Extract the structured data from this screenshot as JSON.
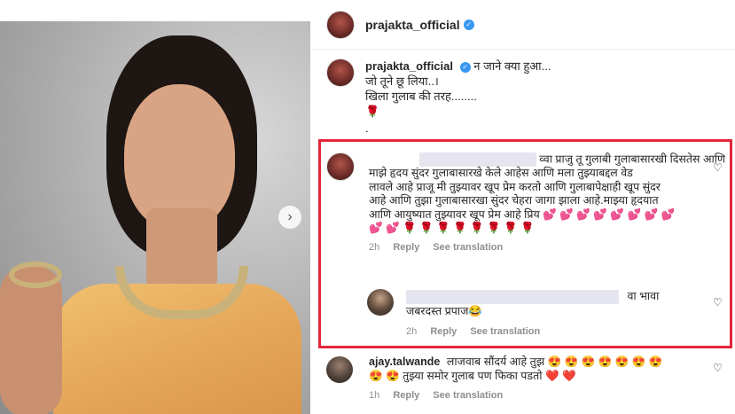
{
  "post": {
    "username": "prajakta_official",
    "verified_icon": "verified-badge-icon",
    "next_icon": "chevron-right-icon"
  },
  "caption": {
    "username": "prajakta_official",
    "line1": "न जाने क्या हुआ...",
    "line2": "जो तूने छू लिया..।",
    "line3": "खिला गुलाब की तरह........",
    "rose": "🌹",
    "dot": "."
  },
  "comments": [
    {
      "text_lines": [
        "व्वा प्राजु तू गुलाबी गुलाबासारखी दिसतेस आणि",
        "माझे हृदय सुंदर गुलाबासारखे केले आहेस आणि मला तुझ्याबद्दल वेड",
        "लावले आहे प्राजू मी तुझ्यावर खूप प्रेम करतो आणि गुलाबापेक्षाही खूप सुंदर",
        "आहे आणि तुझा गुलाबासारखा सुंदर चेहरा जागा झाला आहे.माझ्या हृदयात",
        "आणि आयुष्यात तुझ्यावर खूप प्रेम आहे प्रिय"
      ],
      "emoji_line1": "💕 💕 💕 💕 💕 💕 💕 💕",
      "emoji_line2": "💕 💕 🌹 🌹 🌹 🌹 🌹 🌹 🌹 🌹",
      "time": "2h",
      "reply": "Reply",
      "see": "See translation"
    },
    {
      "text1": "वा भावा",
      "text2": "जबरदस्त प्रपाज",
      "emoji": "😂",
      "time": "2h",
      "reply": "Reply",
      "see": "See translation"
    },
    {
      "username": "ajay.talwande",
      "text1": "लाजवाब सौंदर्य आहे तुझ",
      "emoji1": "😍 😍 😍 😍 😍 😍 😍",
      "emoji2": "😍 😍",
      "text2": "तुझ्या समोर गुलाब पण फिका पडतो",
      "hearts": "❤️ ❤️",
      "time": "1h",
      "reply": "Reply",
      "see": "See translation"
    }
  ],
  "colors": {
    "highlight": "#e3263b",
    "verified": "#3897f0",
    "meta": "#8e8e8e"
  }
}
